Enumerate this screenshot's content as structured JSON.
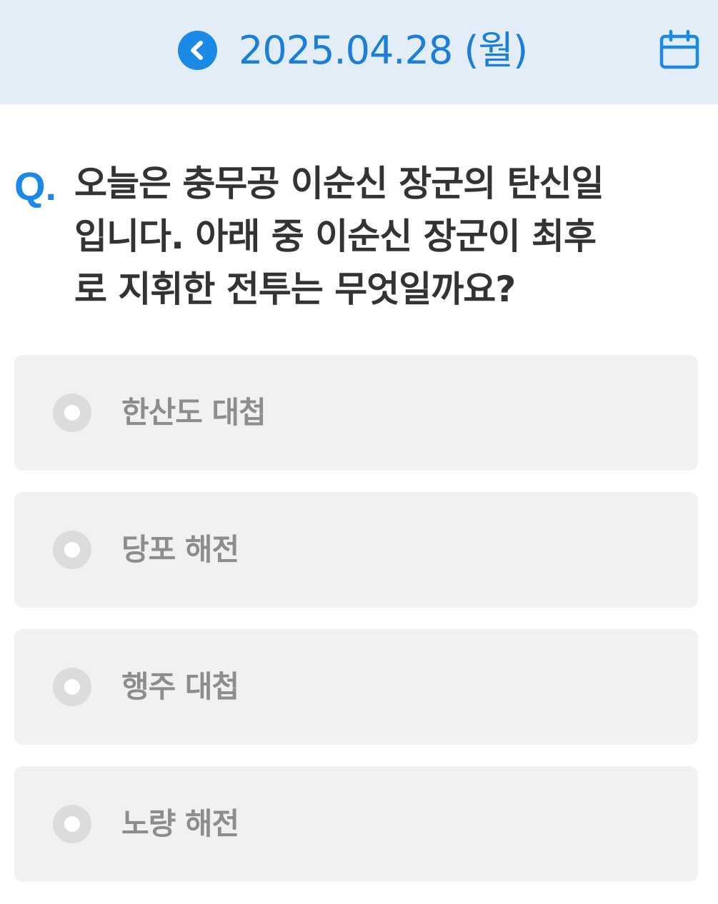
{
  "header": {
    "date": "2025.04.28 (월)",
    "back_icon": "chevron-left-icon",
    "calendar_icon": "calendar-icon",
    "accent_color": "#1a8ae6",
    "background_color": "#e3edf7"
  },
  "question": {
    "marker": "Q.",
    "lines": [
      "오늘은 충무공 이순신 장군의 탄신일",
      "입니다. 아래 중 이순신 장군이 최후",
      "로 지휘한 전투는 무엇일까요?"
    ]
  },
  "options": [
    {
      "label": "한산도 대첩",
      "selected": false
    },
    {
      "label": "당포 해전",
      "selected": false
    },
    {
      "label": "행주 대첩",
      "selected": false
    },
    {
      "label": "노량 해전",
      "selected": false
    }
  ]
}
